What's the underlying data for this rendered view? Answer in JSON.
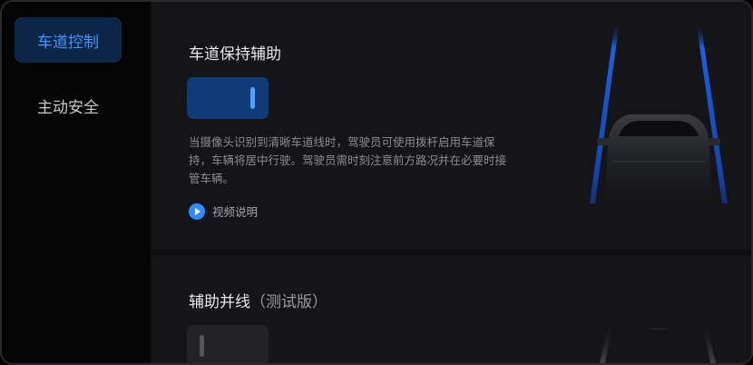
{
  "sidebar": {
    "items": [
      {
        "label": "车道控制",
        "active": true
      },
      {
        "label": "主动安全",
        "active": false
      }
    ]
  },
  "lane_keep": {
    "title": "车道保持辅助",
    "toggle_state": "on",
    "description": "当摄像头识别到清晰车道线时，驾驶员可使用拨杆启用车道保持，车辆将居中行驶。驾驶员需时刻注意前方路况并在必要时接管车辆。",
    "video_label": "视频说明"
  },
  "lane_change": {
    "title": "辅助并线",
    "title_suffix": "（测试版）",
    "toggle_state": "off"
  },
  "colors": {
    "accent": "#2d8cff",
    "active_nav_bg": "#0d2547",
    "toggle_on_bg": "#113a78"
  }
}
